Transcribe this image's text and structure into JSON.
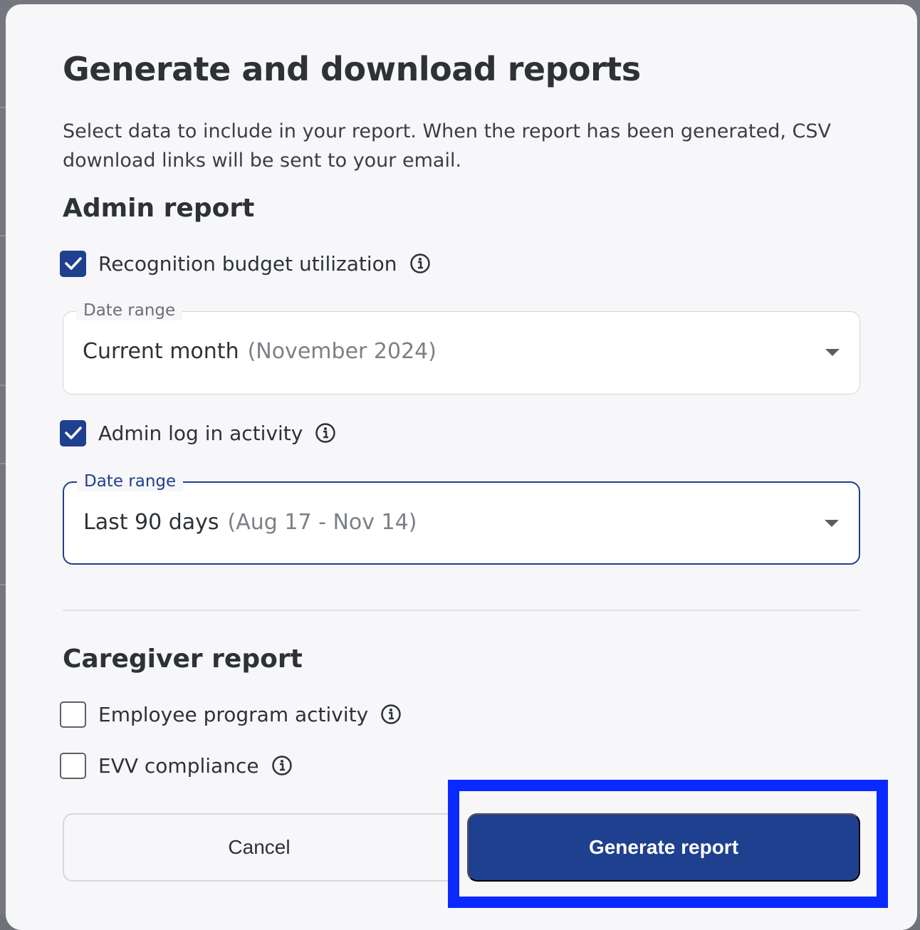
{
  "dialog": {
    "title": "Generate and download reports",
    "description": "Select data to include in your report. When the report has been generated, CSV download links will be sent to your email."
  },
  "admin_report": {
    "heading": "Admin report",
    "items": [
      {
        "label": "Recognition budget utilization",
        "checked": true,
        "date_range": {
          "legend": "Date range",
          "value": "Current month",
          "hint": "(November 2024)",
          "focused": false
        }
      },
      {
        "label": "Admin log in activity",
        "checked": true,
        "date_range": {
          "legend": "Date range",
          "value": "Last 90 days",
          "hint": "(Aug 17 - Nov 14)",
          "focused": true
        }
      }
    ]
  },
  "caregiver_report": {
    "heading": "Caregiver report",
    "items": [
      {
        "label": "Employee program activity",
        "checked": false
      },
      {
        "label": "EVV compliance",
        "checked": false
      }
    ]
  },
  "actions": {
    "cancel_label": "Cancel",
    "generate_label": "Generate report"
  },
  "colors": {
    "primary": "#1f3f8f",
    "highlight": "#0a29ff"
  },
  "icons": {
    "check": "check-icon",
    "info": "info-icon",
    "caret": "caret-down-icon"
  }
}
